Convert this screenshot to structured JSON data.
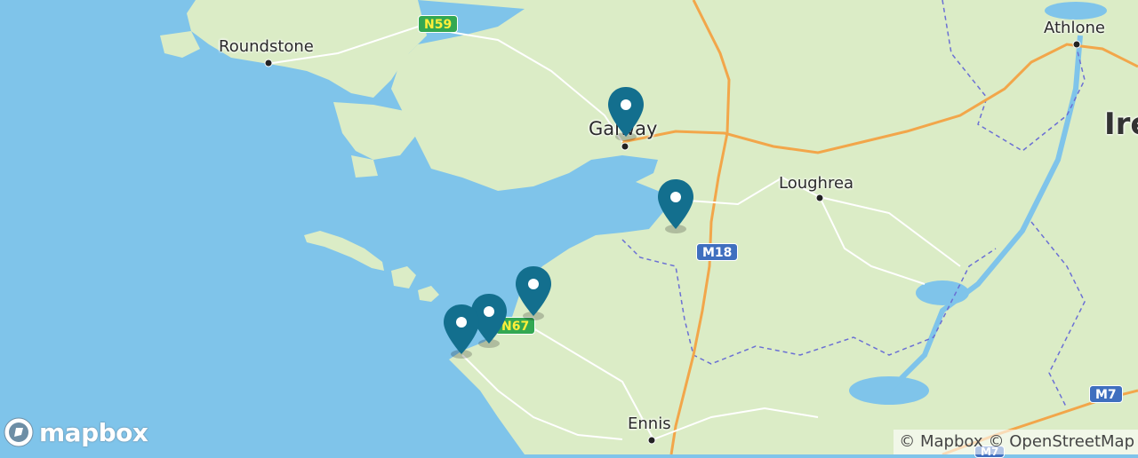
{
  "map": {
    "colors": {
      "water": "#7fc4ea",
      "land": "#dbecc6",
      "road_major": "#f2a64a",
      "road_minor": "#ffffff",
      "border": "#6b70d4",
      "marker": "#136f8e"
    },
    "places": [
      {
        "id": "roundstone",
        "label": "Roundstone"
      },
      {
        "id": "galway",
        "label": "Galway"
      },
      {
        "id": "loughrea",
        "label": "Loughrea"
      },
      {
        "id": "athlone",
        "label": "Athlone"
      },
      {
        "id": "ennis",
        "label": "Ennis"
      },
      {
        "id": "ireland",
        "label": "Ire"
      }
    ],
    "shields": [
      {
        "id": "n59",
        "label": "N59"
      },
      {
        "id": "n67",
        "label": "N67"
      },
      {
        "id": "m18",
        "label": "M18"
      },
      {
        "id": "m7a",
        "label": "M7"
      },
      {
        "id": "m7b",
        "label": "M7"
      }
    ],
    "marker_count": 5
  },
  "logo": {
    "label": "mapbox"
  },
  "attribution": {
    "mapbox": "© Mapbox",
    "osm": "© OpenStreetMap"
  }
}
